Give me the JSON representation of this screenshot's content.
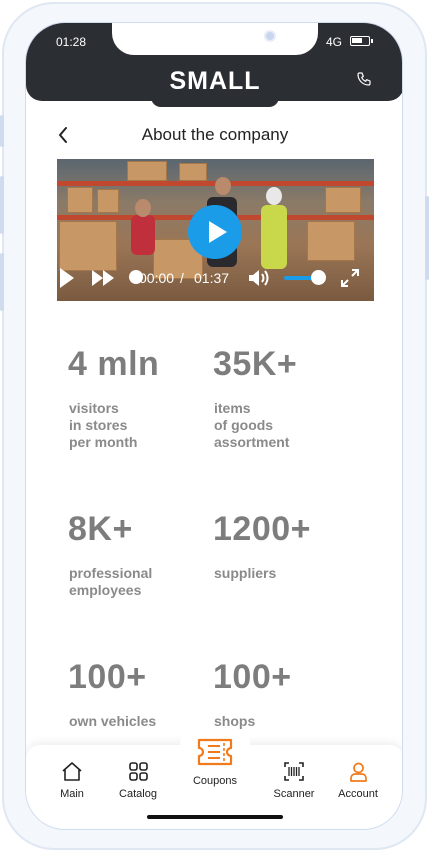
{
  "status": {
    "time": "01:28",
    "network": "4G"
  },
  "header": {
    "brand": "SMALL",
    "call_icon": "phone-icon"
  },
  "page": {
    "title": "About the company",
    "back_icon": "chevron-left-icon"
  },
  "video": {
    "current_time": "00:00",
    "separator": "/",
    "duration": "01:37",
    "progress": 0,
    "volume": 0.9
  },
  "stats": [
    {
      "value": "4 mln",
      "label": "visitors\nin stores\nper month"
    },
    {
      "value": "35K+",
      "label": "items\nof goods\nassortment"
    },
    {
      "value": "8K+",
      "label": "professional\nemployees"
    },
    {
      "value": "1200+",
      "label": "suppliers"
    },
    {
      "value": "100+",
      "label": "own vehicles"
    },
    {
      "value": "100+",
      "label": "shops"
    }
  ],
  "tabs": {
    "main": "Main",
    "catalog": "Catalog",
    "coupons": "Coupons",
    "scanner": "Scanner",
    "account": "Account"
  },
  "colors": {
    "accent": "#1a9ce8",
    "header": "#2b2e33",
    "coupon": "#f07a1c"
  }
}
